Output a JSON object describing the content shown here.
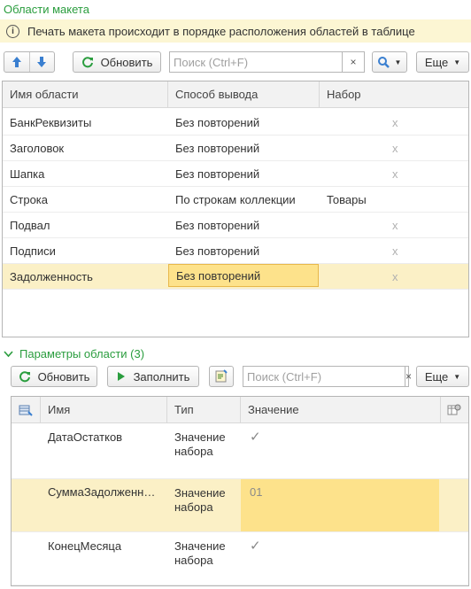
{
  "section1": {
    "title": "Области макета"
  },
  "notice": {
    "text": "Печать макета происходит в порядке расположения областей в таблице"
  },
  "toolbar1": {
    "refresh_label": "Обновить",
    "search_placeholder": "Поиск (Ctrl+F)",
    "clear_label": "×",
    "more_label": "Еще"
  },
  "table1": {
    "columns": [
      "Имя области",
      "Способ вывода",
      "Набор"
    ],
    "rows": [
      {
        "name": "БанкРеквизиты",
        "mode": "Без повторений",
        "set": "x"
      },
      {
        "name": "Заголовок",
        "mode": "Без повторений",
        "set": "x"
      },
      {
        "name": "Шапка",
        "mode": "Без повторений",
        "set": "x"
      },
      {
        "name": "Строка",
        "mode": "По строкам коллекции",
        "set": "Товары"
      },
      {
        "name": "Подвал",
        "mode": "Без повторений",
        "set": "x"
      },
      {
        "name": "Подписи",
        "mode": "Без повторений",
        "set": "x"
      },
      {
        "name": "Задолженность",
        "mode": "Без повторений",
        "set": "x"
      }
    ]
  },
  "section2": {
    "title": "Параметры области (3)"
  },
  "toolbar2": {
    "refresh_label": "Обновить",
    "fill_label": "Заполнить",
    "search_placeholder": "Поиск (Ctrl+F)",
    "clear_label": "×",
    "more_label": "Еще"
  },
  "table2": {
    "columns": [
      "Имя",
      "Тип",
      "Значение"
    ],
    "rows": [
      {
        "name": "ДатаОстатков",
        "type_line1": "Значение",
        "type_line2": "набора",
        "value": "✓"
      },
      {
        "name": "СуммаЗадолженн…",
        "type_line1": "Значение",
        "type_line2": "набора",
        "value": "01"
      },
      {
        "name": "КонецМесяца",
        "type_line1": "Значение",
        "type_line2": "набора",
        "value": "✓"
      }
    ]
  },
  "colors": {
    "accent_green": "#2a9d3e",
    "selection": "#fbf0c6",
    "active_cell": "#fde28b",
    "arrow_blue": "#3a7fd0"
  }
}
